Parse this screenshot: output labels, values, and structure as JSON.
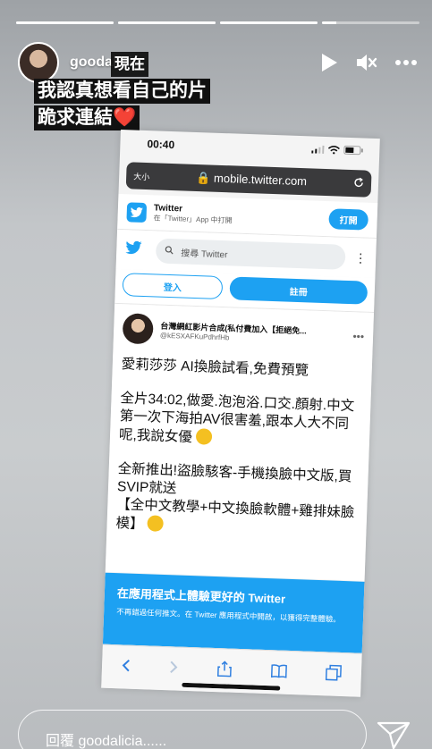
{
  "story": {
    "progress": [
      1,
      1,
      1,
      0.15
    ],
    "username": "goodalicia",
    "icons": [
      "play-icon",
      "mute-icon",
      "more-icon",
      "send-icon"
    ]
  },
  "caption": {
    "line1": "現在",
    "line2": "我認真想看自己的片",
    "line3": "跪求連結❤️"
  },
  "screenshot": {
    "status_time": "00:40",
    "url_size_label": "大小",
    "url": "mobile.twitter.com",
    "banner_title": "Twitter",
    "banner_sub": "在「Twitter」App 中打開",
    "open_button": "打開",
    "search_placeholder": "搜尋 Twitter",
    "login_button": "登入",
    "signup_button": "註冊",
    "tweet_name": "台灣網紅影片合成(私付費加入【拒絕免...",
    "tweet_handle": "@kESXAFKuPdhrfHb",
    "tweet_p1": "愛莉莎莎 AI換臉試看,免費預覽",
    "tweet_p2": "全片34:02,做愛.泡泡浴.口交.顏射.中文\n第一次下海拍AV很害羞,跟本人大不同呢,我說女優",
    "tweet_p3": "全新推出!盜臉駭客-手機換臉中文版,買SVIP就送\n【全中文教學+中文換臉軟體+雞排妹臉模】",
    "openapp_title": "在應用程式上體驗更好的 Twitter",
    "openapp_sub": "不再錯過任何推文。在 Twitter 應用程式中開啟，以獲得完整體驗。"
  },
  "reply": {
    "placeholder": "回覆 goodalicia......"
  }
}
